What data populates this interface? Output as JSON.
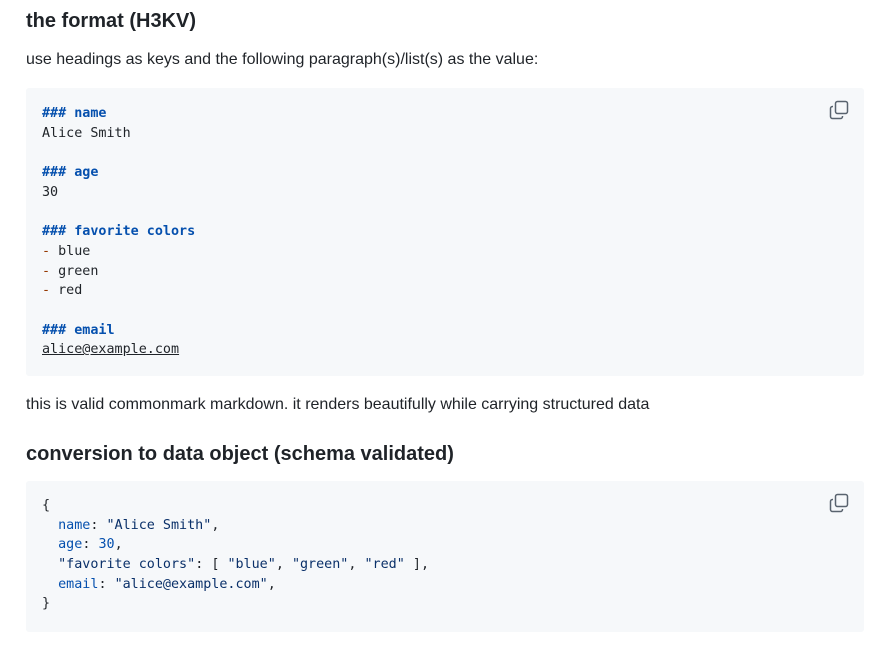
{
  "format_section": {
    "heading": "the format (H3KV)",
    "intro": "use headings as keys and the following paragraph(s)/list(s) as the value:"
  },
  "markdown_block": {
    "heading_name": "### name",
    "value_name": "Alice Smith",
    "heading_age": "### age",
    "value_age": "30",
    "heading_colors": "### favorite colors",
    "bullet_marker": "-",
    "color_1": "blue",
    "color_2": "green",
    "color_3": "red",
    "heading_email": "### email",
    "value_email": "alice@example.com",
    "copy_icon": "copy-icon"
  },
  "valid_note": "this is valid commonmark markdown. it renders beautifully while carrying structured data",
  "conversion_section": {
    "heading": "conversion to data object (schema validated)"
  },
  "json_block": {
    "open_brace": "{",
    "key_name": "name",
    "val_name": "\"Alice Smith\"",
    "key_age": "age",
    "val_age": "30",
    "key_colors": "\"favorite colors\"",
    "val_colors_open": "[",
    "val_color_1": "\"blue\"",
    "val_color_2": "\"green\"",
    "val_color_3": "\"red\"",
    "val_colors_close": "]",
    "key_email": "email",
    "val_email": "\"alice@example.com\"",
    "close_brace": "}",
    "copy_icon": "copy-icon"
  },
  "colors": {
    "code_background": "#f6f8fa",
    "md_heading": "#0550ae",
    "json_string": "#0a3069",
    "text": "#1f2328"
  }
}
